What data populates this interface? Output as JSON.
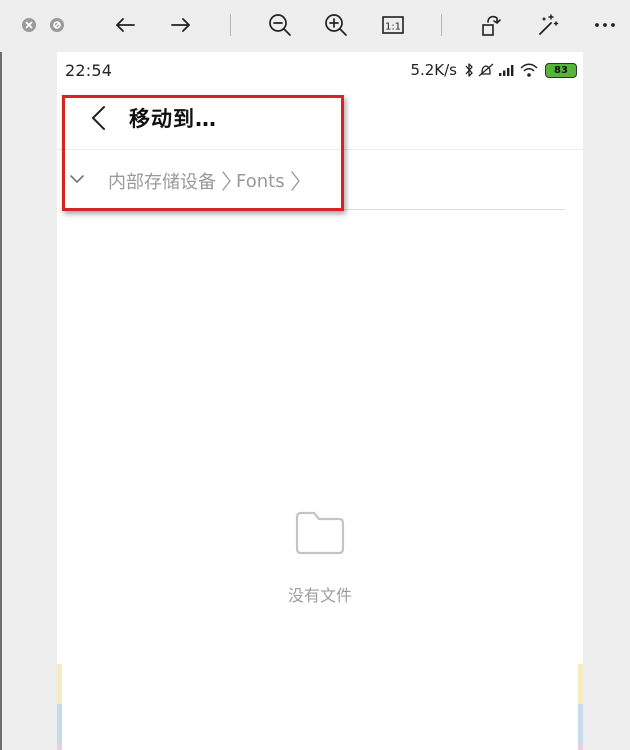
{
  "viewer_toolbar": {
    "buttons": [
      {
        "name": "close-window",
        "icon": "close-icon"
      },
      {
        "name": "minimize-window",
        "icon": "minimize-icon"
      },
      {
        "name": "back",
        "icon": "arrow-left-icon"
      },
      {
        "name": "forward",
        "icon": "arrow-right-icon"
      },
      {
        "name": "zoom-out",
        "icon": "zoom-out-icon"
      },
      {
        "name": "zoom-in",
        "icon": "zoom-in-icon"
      },
      {
        "name": "actual-size",
        "icon": "actual-size-icon",
        "label": "1:1"
      },
      {
        "name": "rotate",
        "icon": "rotate-icon"
      },
      {
        "name": "enhance",
        "icon": "magic-wand-icon"
      },
      {
        "name": "more",
        "icon": "more-icon"
      }
    ]
  },
  "status_bar": {
    "time": "22:54",
    "net_speed": "5.2K/s",
    "icons": [
      "bluetooth-icon",
      "mute-icon",
      "signal-icon",
      "wifi-icon"
    ],
    "battery": "83",
    "battery_color": "#53b53a"
  },
  "header": {
    "title": "移动到…",
    "back_icon": "chevron-left-icon"
  },
  "breadcrumb": {
    "toggle_icon": "chevron-down-icon",
    "items": [
      "内部存储设备",
      "Fonts"
    ],
    "separator_icon": "chevron-right-icon"
  },
  "empty_state": {
    "icon": "folder-icon",
    "text": "没有文件"
  },
  "colors": {
    "highlight": "#d42426",
    "muted_text": "#9a9a9a",
    "edge_strips": [
      "#f6ecc0",
      "#c7dbea",
      "#eccdde"
    ]
  }
}
